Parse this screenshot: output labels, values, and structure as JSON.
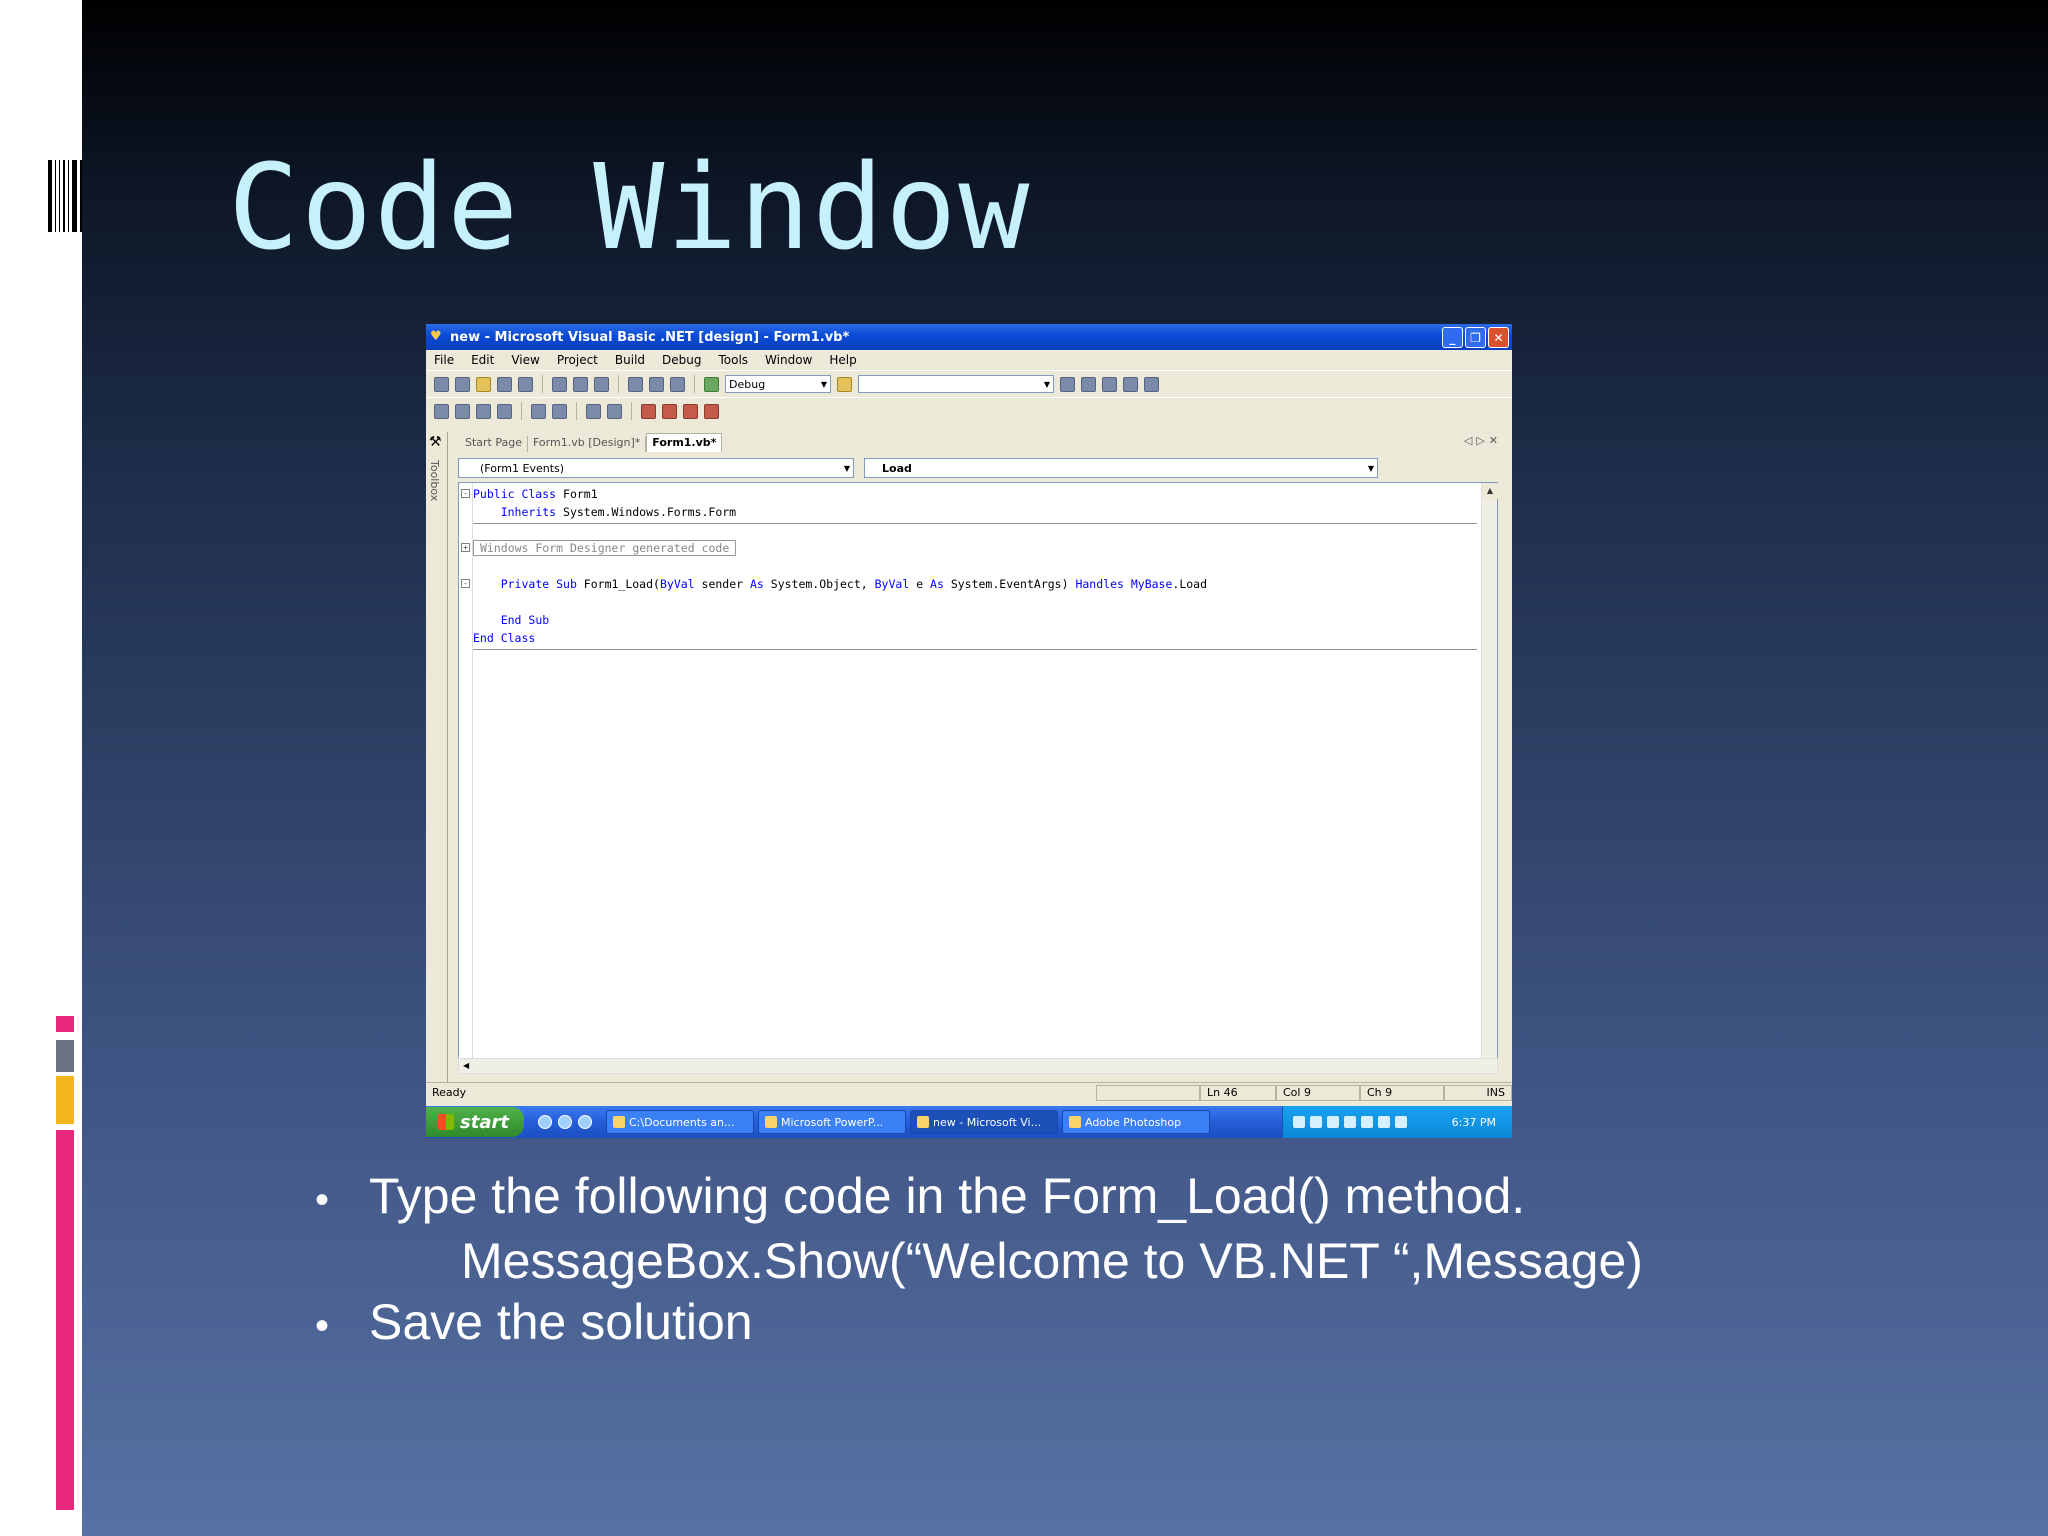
{
  "slide": {
    "title": "Code Window",
    "bullets": [
      "Type the following code in the Form_Load() method.",
      "Save the solution"
    ],
    "code_line": "MessageBox.Show(“Welcome to VB.NET “,Message)"
  },
  "window": {
    "title": "new - Microsoft Visual Basic .NET [design] - Form1.vb*",
    "menu": [
      "File",
      "Edit",
      "View",
      "Project",
      "Build",
      "Debug",
      "Tools",
      "Window",
      "Help"
    ],
    "config_combo": "Debug",
    "doc_tabs": [
      "Start Page",
      "Form1.vb [Design]*",
      "Form1.vb*"
    ],
    "toolbox_label": "Toolbox",
    "object_combo": "(Form1 Events)",
    "event_combo": "Load",
    "code": {
      "l1_kw": "Public Class",
      "l1_rest": " Form1",
      "l2_kw": "Inherits",
      "l2_rest": " System.Windows.Forms.Form",
      "region": "Windows Form Designer generated code",
      "l4_kw1": "Private Sub",
      "l4_t1": " Form1_Load(",
      "l4_kw2": "ByVal",
      "l4_t2": " sender ",
      "l4_kw3": "As",
      "l4_t3": " System.Object, ",
      "l4_kw4": "ByVal",
      "l4_t4": " e ",
      "l4_kw5": "As",
      "l4_t5": " System.EventArgs) ",
      "l4_kw6": "Handles",
      "l4_t6": " ",
      "l4_kw7": "MyBase",
      "l4_t7": ".Load",
      "l5_kw": "End Sub",
      "l6_kw": "End Class"
    },
    "status": {
      "text": "Ready",
      "ln": "Ln 46",
      "col": "Col 9",
      "ch": "Ch 9",
      "ins": "INS"
    }
  },
  "taskbar": {
    "start": "start",
    "tasks": [
      "C:\\Documents an...",
      "Microsoft PowerP...",
      "new - Microsoft Vi...",
      "Adobe Photoshop"
    ],
    "clock": "6:37 PM"
  }
}
